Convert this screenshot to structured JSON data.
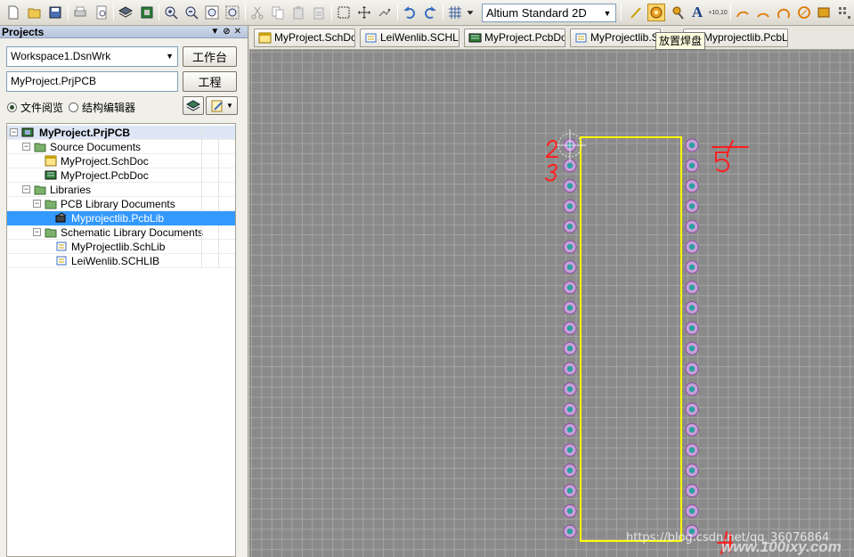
{
  "toolbar": {
    "view_mode": "Altium Standard 2D",
    "icons": [
      "new-file-icon",
      "open-folder-icon",
      "save-icon",
      "print-icon",
      "print-preview-icon",
      "layers-icon",
      "board-icon",
      "zoom-in-icon",
      "zoom-out-icon",
      "zoom-fit-icon",
      "zoom-area-icon",
      "cut-icon",
      "copy-icon",
      "paste-icon",
      "paste-special-icon",
      "select-rect-icon",
      "move-icon",
      "cross-probe-icon",
      "undo-icon",
      "redo-icon",
      "grid-icon",
      "place-line-icon",
      "place-pad-icon",
      "place-via-icon",
      "place-string-icon",
      "coordinate-icon",
      "arc-center-icon",
      "arc-edge-icon",
      "arc-any-icon",
      "circle-icon",
      "fill-icon",
      "array-paste-icon"
    ]
  },
  "panel": {
    "title": "Projects",
    "workspace": "Workspace1.DsnWrk",
    "workspace_button": "工作台",
    "project": "MyProject.PrjPCB",
    "project_button": "工程",
    "radio_file_view": "文件阅览",
    "radio_struct_editor": "结构编辑器"
  },
  "tree": {
    "root": "MyProject.PrjPCB",
    "source_documents": "Source Documents",
    "sch_doc": "MyProject.SchDoc",
    "pcb_doc": "MyProject.PcbDoc",
    "libraries": "Libraries",
    "pcb_library_documents": "PCB Library Documents",
    "pcb_lib": "Myprojectlib.PcbLib",
    "schematic_library_documents": "Schematic Library Documents",
    "sch_lib1": "MyProjectlib.SchLib",
    "sch_lib2": "LeiWenlib.SCHLIB"
  },
  "tabs": [
    {
      "label": "MyProject.SchDoc",
      "icon": "schematic-doc-icon"
    },
    {
      "label": "LeiWenlib.SCHLIB",
      "icon": "schlib-icon"
    },
    {
      "label": "MyProject.PcbDoc",
      "icon": "pcb-doc-icon"
    },
    {
      "label": "MyProjectlib.Sc",
      "icon": "schlib-icon"
    },
    {
      "label": "Myprojectlib.PcbLib",
      "icon": "pcblib-icon"
    }
  ],
  "tooltip": "放置焊盘",
  "canvas": {
    "pads_per_side": 20,
    "annotations": [
      "1",
      "2",
      "3",
      "5",
      "4"
    ],
    "watermark": "https://blog.csdn.net/qq_36076864",
    "site_logo": "www.100ixy.com"
  },
  "colors": {
    "grid_bg": "#8a8a8a",
    "outline": "#ffff00",
    "pad_ring": "#c8a0d8",
    "pad_hole": "#2aa0a0",
    "annotation_red": "#ff2020",
    "selection": "#3399ff"
  }
}
